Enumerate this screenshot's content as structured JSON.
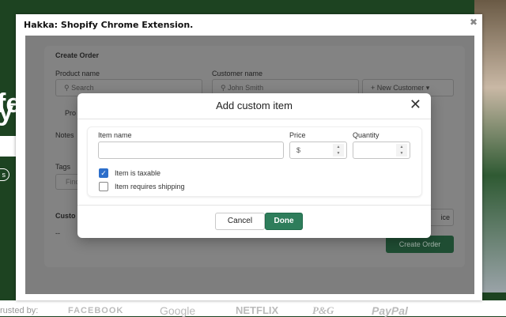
{
  "background": {
    "hero_fragment_1": "fe",
    "hero_fragment_2": "y",
    "pill_fragment": "s",
    "trusted_by": "rusted by:",
    "logos": [
      "FACEBOOK",
      "Google",
      "NETFLIX",
      "P&G",
      "PayPal"
    ]
  },
  "window": {
    "title": "Hakka: Shopify Chrome Extension.",
    "close": "✖"
  },
  "create_order": {
    "title": "Create Order",
    "product_label": "Product name",
    "product_placeholder": "Search",
    "customer_label": "Customer name",
    "customer_value": "John Smith",
    "new_customer": "+ New Customer",
    "tab_fragment": "Pro",
    "notes_label": "Notes",
    "tags_label": "Tags",
    "tags_placeholder": "Find",
    "customer_section": "Custo",
    "dash1": "--",
    "dash2": "--",
    "invoice_fragment": "ice",
    "create_order_button": "Create Order"
  },
  "modal": {
    "title": "Add custom item",
    "item_name_label": "Item name",
    "item_name_value": "",
    "price_label": "Price",
    "price_prefix": "$",
    "quantity_label": "Quantity",
    "taxable_label": "Item is taxable",
    "taxable_checked": true,
    "shipping_label": "Item requires shipping",
    "shipping_checked": false,
    "cancel": "Cancel",
    "done": "Done"
  },
  "colors": {
    "primary": "#2e7d5b",
    "checkbox": "#2c6ecb",
    "background": "#1d4321"
  }
}
